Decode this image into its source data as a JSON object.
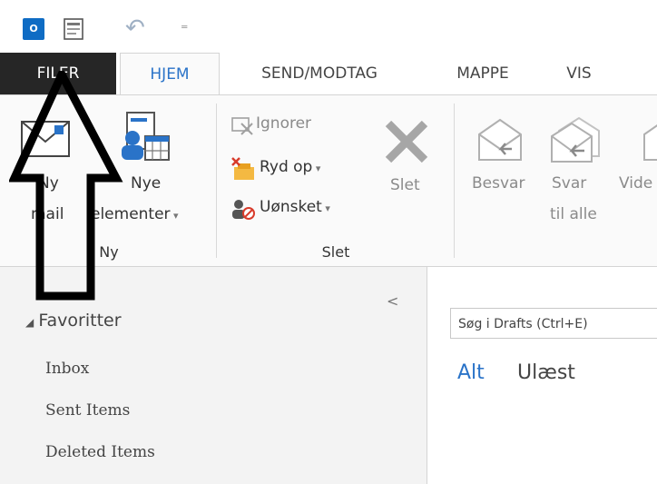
{
  "qat": {
    "app_icon": "outlook-icon",
    "app_icon_text": "O",
    "tools": [
      "document-icon",
      "undo-icon",
      "dropdown-icon"
    ],
    "undo_glyph": "↶",
    "dropdown_glyph": "₌"
  },
  "tabs": [
    {
      "label": "FILER",
      "active": false
    },
    {
      "label": "HJEM",
      "active": true
    },
    {
      "label": "SEND/MODTAG",
      "active": false
    },
    {
      "label": "MAPPE",
      "active": false
    },
    {
      "label": "VIS",
      "active": false
    }
  ],
  "ribbon": {
    "ny_group": {
      "label": "Ny",
      "new_mail": [
        "Ny",
        "mail"
      ],
      "new_items": [
        "Nye",
        "elementer"
      ]
    },
    "slet_group": {
      "label": "Slet",
      "ignore": "Ignorer",
      "cleanup": "Ryd op",
      "junk": "Uønsket",
      "delete": "Slet"
    },
    "respond": {
      "reply": "Besvar",
      "reply_all": [
        "Svar",
        "til alle"
      ],
      "forward_partial": "Vide"
    }
  },
  "nav": {
    "favorites_header": "Favoritter",
    "favorites_triangle": "◢",
    "collapse_glyph": "<",
    "items": [
      "Inbox",
      "Sent Items",
      "Deleted Items"
    ]
  },
  "mail": {
    "search_placeholder": "Søg i Drafts (Ctrl+E)",
    "filter_all": "Alt",
    "filter_unread": "Ulæst"
  },
  "colors": {
    "accent": "#2a73c8",
    "filer_bg": "#262626",
    "ribbon_bg": "#fafafa",
    "nav_bg": "#f3f3f3"
  }
}
